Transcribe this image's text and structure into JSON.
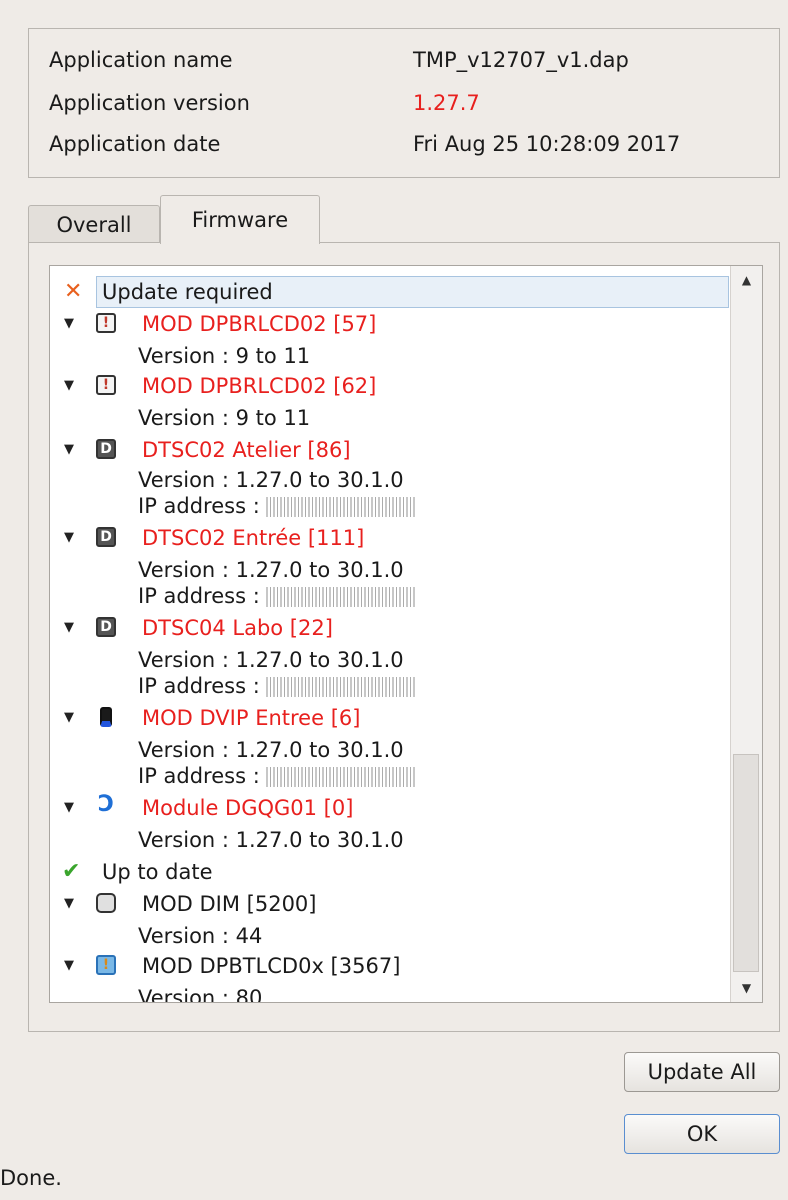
{
  "app_info": {
    "rows": [
      {
        "label": "Application name",
        "value": "TMP_v12707_v1.dap"
      },
      {
        "label": "Application version",
        "value": "1.27.7"
      },
      {
        "label": "Application date",
        "value": "Fri Aug 25 10:28:09 2017"
      }
    ]
  },
  "tabs": [
    {
      "label": "Overall",
      "active": false
    },
    {
      "label": "Firmware",
      "active": true
    }
  ],
  "tree": {
    "groups": {
      "update_required": "Update required",
      "up_to_date": "Up to date"
    },
    "devices": [
      {
        "name": "MOD DPBRLCD02 [57]",
        "icon": "thermostat-icon",
        "version": "Version : 9 to 11"
      },
      {
        "name": "MOD DPBRLCD02 [62]",
        "icon": "thermostat-icon",
        "version": "Version : 9 to 11"
      },
      {
        "name": "DTSC02 Atelier [86]",
        "icon": "touchscreen-icon",
        "version": "Version : 1.27.0 to 30.1.0",
        "ip": "IP address :"
      },
      {
        "name": "DTSC02 Entrée [111]",
        "icon": "touchscreen-icon",
        "version": "Version : 1.27.0 to 30.1.0",
        "ip": "IP address :"
      },
      {
        "name": "DTSC04 Labo [22]",
        "icon": "touchscreen-icon",
        "version": "Version : 1.27.0 to 30.1.0",
        "ip": "IP address :"
      },
      {
        "name": "MOD DVIP Entree [6]",
        "icon": "intercom-icon",
        "version": "Version : 1.27.0 to 30.1.0",
        "ip": "IP address :"
      },
      {
        "name": "Module DGQG01 [0]",
        "icon": "gateway-icon",
        "version": "Version : 1.27.0 to 30.1.0"
      },
      {
        "name": "MOD DIM [5200]",
        "icon": "dimmer-icon",
        "version": "Version : 44"
      },
      {
        "name": "MOD DPBTLCD0x [3567]",
        "icon": "thermostat-icon",
        "version": "Version : 80"
      }
    ]
  },
  "buttons": {
    "update_all": "Update All",
    "ok": "OK"
  },
  "status": "Done.",
  "colors": {
    "error_red": "#e8201e",
    "ok_green": "#3aa52d",
    "x_orange": "#e8601e"
  }
}
